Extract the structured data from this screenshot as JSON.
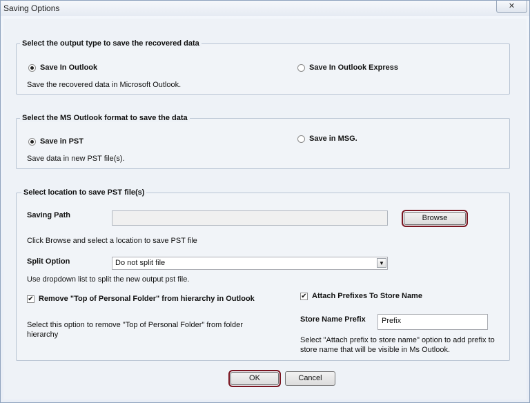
{
  "window": {
    "title": "Saving Options",
    "close_glyph": "✕"
  },
  "output_group": {
    "legend": "Select the output type to save the recovered data",
    "option_outlook": "Save In Outlook",
    "option_express": "Save In Outlook Express",
    "description": "Save the recovered data in Microsoft Outlook.",
    "selected": "Save In Outlook"
  },
  "format_group": {
    "legend": "Select the MS Outlook format to save the data",
    "option_pst": "Save in PST",
    "option_msg": "Save in MSG.",
    "description": "Save data in new PST file(s).",
    "selected": "Save in PST"
  },
  "location_group": {
    "legend": "Select location to save PST file(s)",
    "saving_path_label": "Saving Path",
    "saving_path_value": "",
    "browse_label": "Browse",
    "browse_hint": "Click Browse and select a location to save PST file",
    "split_label": "Split Option",
    "split_value": "Do not split file",
    "split_hint": "Use dropdown list to split the new output pst file.",
    "remove_top_label": "Remove \"Top of Personal Folder\" from hierarchy in Outlook",
    "remove_top_checked": true,
    "remove_top_hint": "Select this option to remove \"Top of Personal Folder\" from folder hierarchy",
    "attach_prefix_label": "Attach Prefixes To Store Name",
    "attach_prefix_checked": true,
    "store_prefix_label": "Store Name Prefix",
    "store_prefix_value": "Prefix",
    "prefix_hint": "Select \"Attach prefix to store name\" option to add prefix to store name that will be visible in Ms Outlook."
  },
  "footer": {
    "ok_label": "OK",
    "cancel_label": "Cancel"
  },
  "icons": {
    "check": "✔",
    "dropdown_arrow": "▼"
  },
  "colors": {
    "focus_outline": "#7a1520",
    "group_border": "#b8c4d3"
  }
}
